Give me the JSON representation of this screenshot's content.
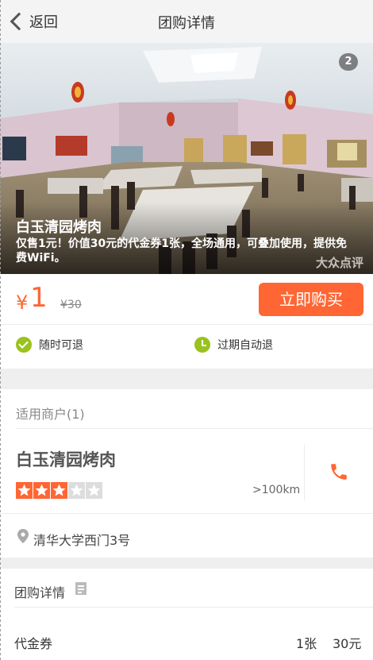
{
  "nav": {
    "back_label": "返回",
    "title": "团购详情"
  },
  "hero": {
    "image_count": "2",
    "name": "白玉清园烤肉",
    "description": "仅售1元！价值30元的代金券1张，全场通用，可叠加使用，提供免费WiFi。",
    "watermark": "大众点评"
  },
  "price": {
    "currency": "¥",
    "current": "1",
    "original": "¥30",
    "buy_label": "立即购买"
  },
  "guarantees": [
    {
      "label": "随时可退",
      "icon": "check-icon"
    },
    {
      "label": "过期自动退",
      "icon": "clock-icon"
    }
  ],
  "merchants": {
    "title": "适用商户(1)",
    "items": [
      {
        "name": "白玉清园烤肉",
        "rating": 3,
        "max_rating": 5,
        "distance": ">100km",
        "address": "清华大学西门3号"
      }
    ]
  },
  "detail": {
    "title": "团购详情",
    "rows": [
      {
        "label": "代金券",
        "quantity": "1张",
        "value": "30元"
      }
    ]
  },
  "colors": {
    "accent": "#ff6633",
    "green": "#9ac21e",
    "star_empty": "#dddddd"
  }
}
